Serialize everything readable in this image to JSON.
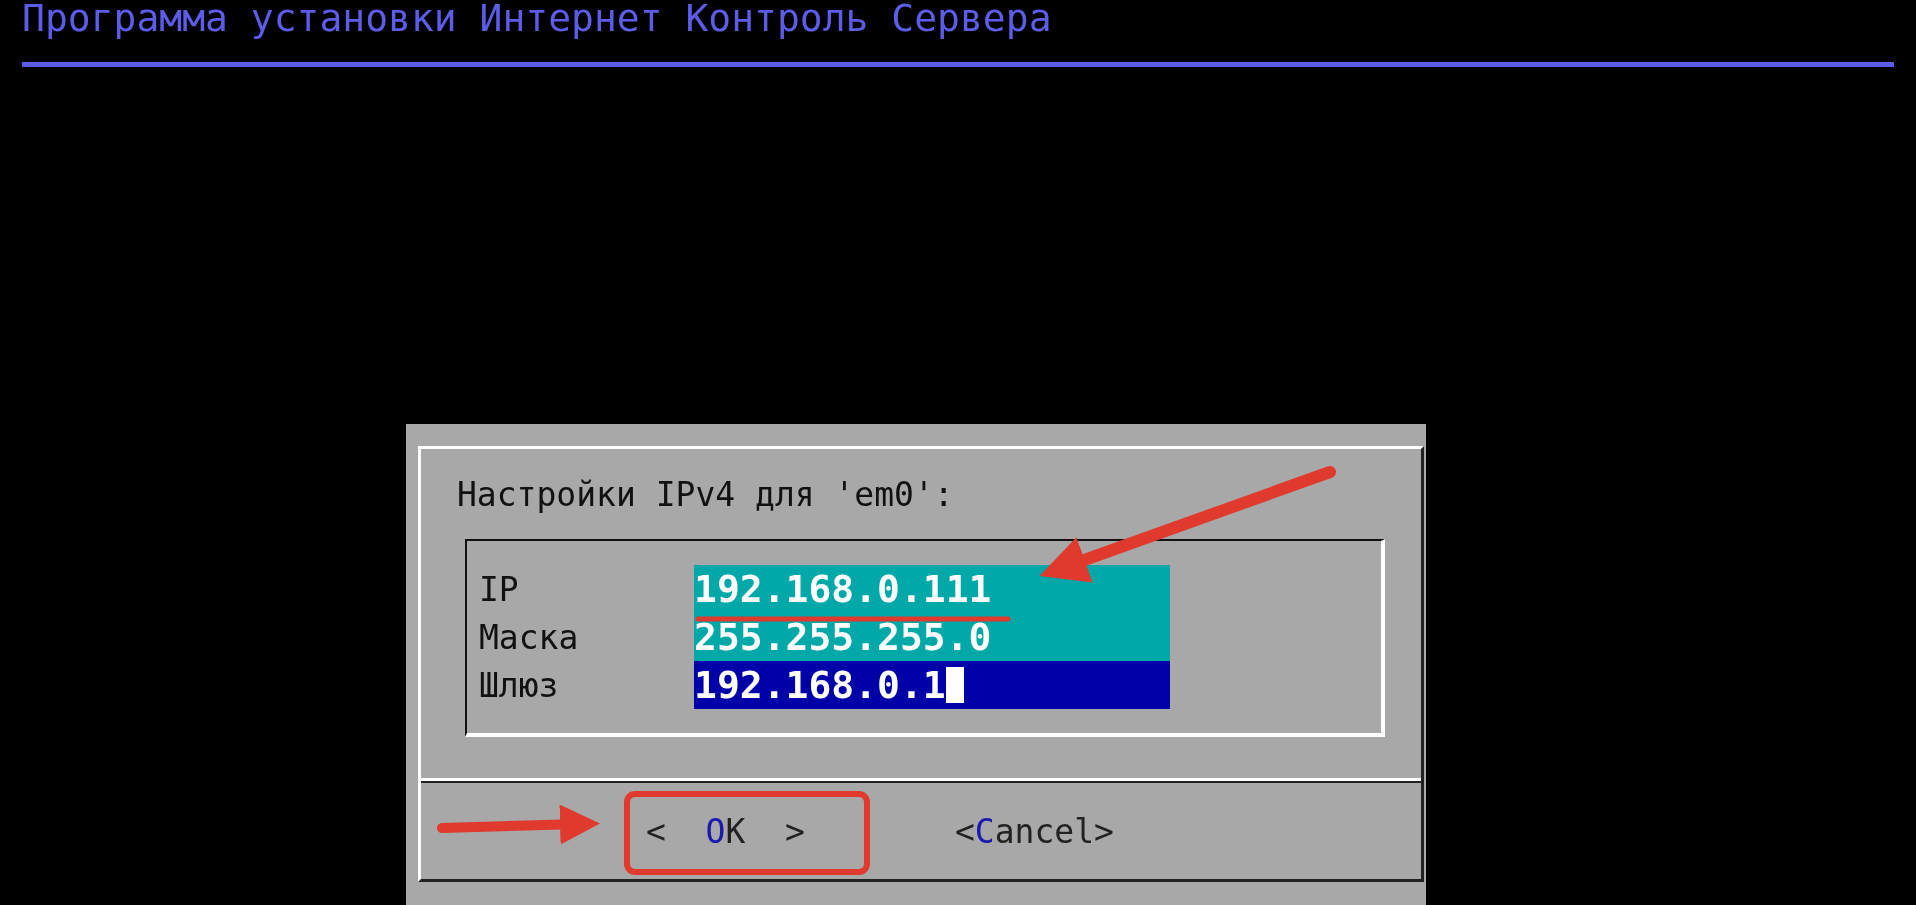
{
  "header": {
    "title": "Программа установки Интернет Контроль Сервера"
  },
  "dialog": {
    "prompt": "Настройки IPv4 для 'em0':",
    "fields": [
      {
        "label": "IP",
        "value": "192.168.0.111",
        "focused": false
      },
      {
        "label": "Маска",
        "value": "255.255.255.0",
        "focused": false
      },
      {
        "label": "Шлюз",
        "value": "192.168.0.1",
        "focused": true
      }
    ],
    "buttons": [
      {
        "open": "<  ",
        "hotkey": "O",
        "rest": "K",
        "close": "  >"
      },
      {
        "open": "<",
        "hotkey": "C",
        "rest": "ancel",
        "close": ">"
      }
    ]
  }
}
